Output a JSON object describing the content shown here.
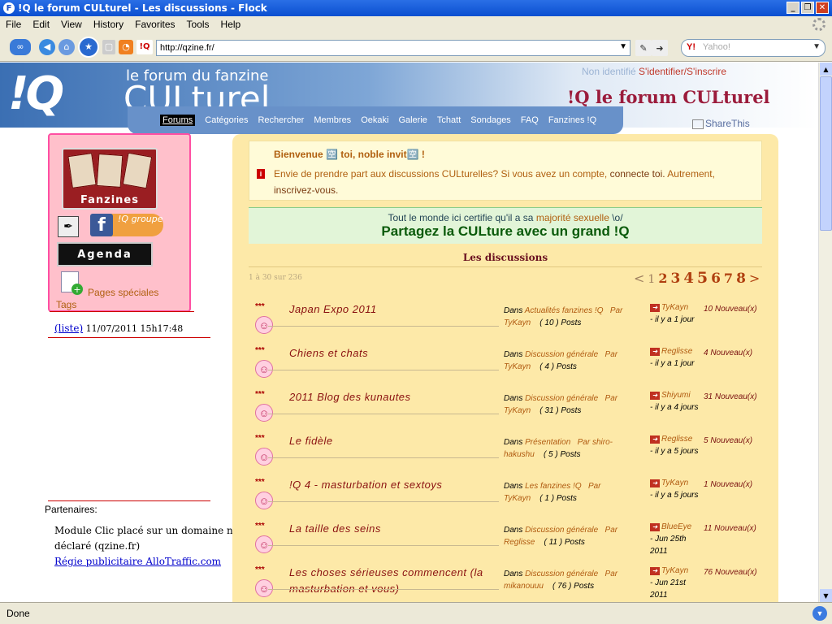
{
  "window": {
    "title": "!Q le forum CULturel - Les discussions - Flock",
    "buttons": [
      "_",
      "❐",
      "✕"
    ]
  },
  "menu": [
    "File",
    "Edit",
    "View",
    "History",
    "Favorites",
    "Tools",
    "Help"
  ],
  "nav": {
    "url": "http://qzine.fr/",
    "search_placeholder": "Yahoo!"
  },
  "status": "Done",
  "header": {
    "logo_iq": "!Q",
    "logo_sub": "le forum du fanzine",
    "logo_cult": "CULturel",
    "login_prefix": "Non identifié ",
    "login_link": "S'identifier/S'inscrire",
    "forum_title": "!Q le forum CULturel",
    "sharethis": "ShareThis",
    "tabs": [
      "Forums",
      "Catégories",
      "Rechercher",
      "Membres",
      "Oekaki",
      "Galerie",
      "Tchatt",
      "Sondages",
      "FAQ",
      "Fanzines !Q"
    ]
  },
  "sidebar": {
    "fanzines_label": "Fanzines",
    "fb_group_label": "!Q groupe",
    "fb_letter": "f",
    "agenda_label": "Agenda",
    "pages_speciales": "Pages spéciales",
    "tags": "Tags",
    "liste": "(liste)",
    "liste_date": " 11/07/2011 15h17:48",
    "partners_label": "Partenaires:",
    "partners_text": "Module Clic placé sur un domaine non déclaré (qzine.fr)",
    "partners_link": "Régie publicitaire AlloTraffic.com"
  },
  "main": {
    "welcome_title": "Bienvenue 🈳 toi, noble invit🈳 !",
    "welcome_text": "Envie de prendre part aux discussions CULturelles? Si vous avez un compte, ",
    "welcome_link1": "connecte toi.",
    "welcome_text2": " Autrement, ",
    "welcome_link2": "inscrivez-vous.",
    "certify_text": "Tout le monde ici certifie qu'il a sa ",
    "certify_link": "majorité sexuelle",
    "certify_end": " \\o/",
    "certify_title": "Partagez la CULture avec un grand !Q",
    "discussions_title": "Les discussions",
    "page_count": "1 à 30 sur 236",
    "pager": [
      "<",
      "1",
      "2",
      "3",
      "4",
      "5",
      "6",
      "7",
      "8",
      ">"
    ]
  },
  "topics": [
    {
      "stars": "***",
      "title": "Japan Expo 2011",
      "dans": "Dans ",
      "category": "Actualités fanzines !Q",
      "par": "Par",
      "author": "TyKayn",
      "posts": "( 10 ) Posts",
      "last_user": "TyKayn",
      "last_time": "- il y a 1 jour",
      "new": "10 Nouveau(x)"
    },
    {
      "stars": "***",
      "title": "Chiens et chats",
      "dans": "Dans ",
      "category": "Discussion générale",
      "par": "Par",
      "author": "TyKayn",
      "posts": "( 4 ) Posts",
      "last_user": "Reglisse",
      "last_time": "- il y a 1 jour",
      "new": "4 Nouveau(x)"
    },
    {
      "stars": "***",
      "title": "2011 Blog des kunautes",
      "dans": "Dans ",
      "category": "Discussion générale",
      "par": "Par",
      "author": "TyKayn",
      "posts": "( 31 ) Posts",
      "last_user": "Shiyumi",
      "last_time": "- il y a 4 jours",
      "new": "31 Nouveau(x)"
    },
    {
      "stars": "***",
      "title": "Le fidèle",
      "dans": "Dans ",
      "category": "Présentation",
      "par": "Par",
      "author": "shiro-hakushu",
      "posts": "( 5 ) Posts",
      "last_user": "Reglisse",
      "last_time": "- il y a 5 jours",
      "new": "5 Nouveau(x)"
    },
    {
      "stars": "***",
      "title": "!Q 4 - masturbation et sextoys",
      "dans": "Dans ",
      "category": "Les fanzines !Q",
      "par": "Par",
      "author": "TyKayn",
      "posts": "( 1 ) Posts",
      "last_user": "TyKayn",
      "last_time": "- il y a 5 jours",
      "new": "1 Nouveau(x)"
    },
    {
      "stars": "***",
      "title": "La taille des seins",
      "dans": "Dans ",
      "category": "Discussion générale",
      "par": "Par",
      "author": "Reglisse",
      "posts": "( 11 ) Posts",
      "last_user": "BlueEye",
      "last_time": "- Jun 25th 2011",
      "new": "11 Nouveau(x)"
    },
    {
      "stars": "***",
      "title": "Les choses sérieuses commencent (la masturbation et vous)",
      "dans": "Dans ",
      "category": "Discussion générale",
      "par": "Par",
      "author": "mikanouuu",
      "posts": "( 76 ) Posts",
      "last_user": "TyKayn",
      "last_time": "- Jun 21st 2011",
      "new": "76 Nouveau(x)"
    }
  ]
}
